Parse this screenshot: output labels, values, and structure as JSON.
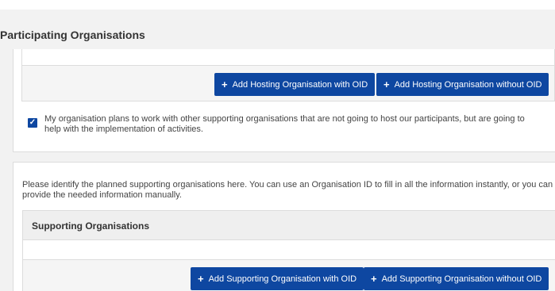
{
  "section": {
    "title": "Participating Organisations"
  },
  "hosting": {
    "add_with_oid": "Add Hosting Organisation with OID",
    "add_without_oid": "Add Hosting Organisation without OID"
  },
  "supporting_checkbox": {
    "checked": true,
    "label": "My organisation plans to work with other supporting organisations that are not going to host our participants, but are going to help with the implementation of activities."
  },
  "supporting": {
    "description": "Please identify the planned supporting organisations here. You can use an Organisation ID to fill in all the information instantly, or you can provide the needed information manually.",
    "heading": "Supporting Organisations",
    "add_with_oid": "Add Supporting Organisation with OID",
    "add_without_oid": "Add Supporting Organisation without OID"
  },
  "colors": {
    "primary": "#0e47a1",
    "background": "#f2f2f2"
  }
}
